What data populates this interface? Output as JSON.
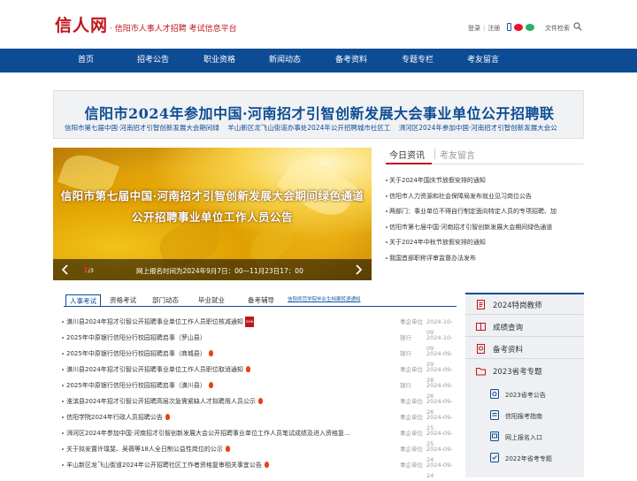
{
  "header": {
    "logo": "信人网",
    "slogan": "· 信阳市人事人才招聘 考试信息平台",
    "login": "登录",
    "register": "注册",
    "file_search": "文件检索"
  },
  "nav": [
    "首页",
    "招考公告",
    "职业资格",
    "新闻动态",
    "备考资料",
    "专题专栏",
    "考友留言"
  ],
  "banner": {
    "title": "信阳市2024年参加中国·河南招才引智创新发展大会事业单位公开招聘联",
    "marquee": [
      "信阳市第七届中国·河南招才引智创新发展大会期间绿",
      "羊山新区龙飞山街道办事处2024年公开招聘城市社区工",
      "浉河区2024年参加中国·河南招才引智创新发展大会公"
    ]
  },
  "slider": {
    "line1": "信阳市第七届中国·河南招才引智创新发展大会期间绿色通道",
    "line2": "公开招聘事业单位工作人员公告",
    "caption": "网上报名时间为2024年9月7日：00—11月23日17：00",
    "page_current": "1",
    "page_total": "/3"
  },
  "news": {
    "tab_active": "今日资讯",
    "tab_other": "考友留言",
    "items": [
      "关于2024年国庆节放假安排的通知",
      "信阳市人力资源和社会保障局发布就业见习岗位公告",
      "两部门：事业单位不得自行制定面向特定人员的专项招聘、加",
      "信阳市第七届中国·河南招才引智创新发展大会期间绿色通道",
      "关于2024年中秋节放假安排的通知",
      "我国首部职称评审监督办法发布"
    ]
  },
  "list": {
    "tabs": [
      "人事考试",
      "资格考试",
      "部门动态",
      "毕业就业",
      "备考辅导"
    ],
    "marquee": "信阳师范学院毕业生档案转递通知",
    "rows": [
      {
        "title": "潢川县2024年招才引智公开招聘事业单位工作人员职位核减通知",
        "tag": "new",
        "cat": "事企单位",
        "date": "2024-10-09"
      },
      {
        "title": "2025年中原银行信阳分行校园招聘启事（罗山县）",
        "tag": "",
        "cat": "银行",
        "date": "2024-10-09"
      },
      {
        "title": "2025年中原银行信阳分行校园招聘启事（商城县）",
        "tag": "fire",
        "cat": "银行",
        "date": "2024-09-29"
      },
      {
        "title": "潢川县2024年招才引智公开招聘事业单位工作人员职位取消通知",
        "tag": "fire",
        "cat": "事企单位",
        "date": "2024-09-28"
      },
      {
        "title": "2025年中原银行信阳分行校园招聘启事（潢川县）",
        "tag": "fire",
        "cat": "银行",
        "date": "2024-09-26"
      },
      {
        "title": "淮滨县2024年招才引智公开招聘高层次急需紧缺人才拟聘用人员公示",
        "tag": "fire",
        "cat": "事企单位",
        "date": "2024-09-26"
      },
      {
        "title": "信阳学院2024年行政人员招聘公告",
        "tag": "fire",
        "cat": "事企单位",
        "date": "2024-09-25"
      },
      {
        "title": "浉河区2024年参加中国·河南招才引智创新发展大会公开招聘事业单位工作人员笔试成绩及进入资格复...",
        "tag": "",
        "cat": "事企单位",
        "date": "2024-09-25"
      },
      {
        "title": "关于拟安置许璞斐、吴薇等18人全日制公益性岗位的公示",
        "tag": "fire",
        "cat": "事企单位",
        "date": "2024-09-24"
      },
      {
        "title": "羊山新区龙飞山街道2024年公开招聘社区工作者资格复审相关事宜公告",
        "tag": "fire",
        "cat": "事企单位",
        "date": "2024-09-24"
      }
    ]
  },
  "side": {
    "items": [
      "2024特岗教师",
      "成绩查询",
      "备考资料",
      "2023省考专题"
    ],
    "subitems": [
      "2023省考公告",
      "信阳报考指南",
      "网上报名入口",
      "2022年省考专题"
    ]
  },
  "colors": {
    "brand_red": "#c0141b",
    "nav_blue": "#0d4c94"
  }
}
